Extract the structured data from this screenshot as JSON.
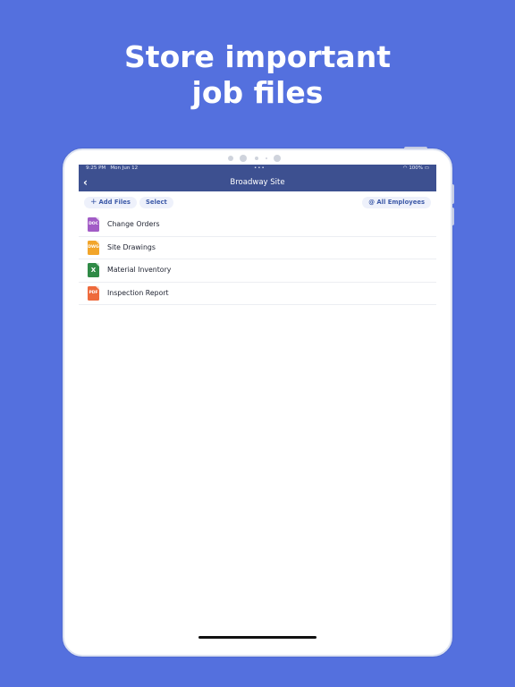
{
  "headline": {
    "line1": "Store important",
    "line2": "job files"
  },
  "status_bar": {
    "time": "9:25 PM",
    "date": "Mon Jun 12",
    "dots": "•••",
    "battery": "100%"
  },
  "nav": {
    "back_glyph": "‹",
    "title": "Broadway Site"
  },
  "toolbar": {
    "add_files_icon": "+",
    "add_files_label": "Add Files",
    "select_label": "Select",
    "filter_icon": "@",
    "filter_label": "All Employees"
  },
  "files": [
    {
      "name": "Change Orders",
      "type": "DOC",
      "color": "#a25cc6"
    },
    {
      "name": "Site Drawings",
      "type": "DWG",
      "color": "#f2a52a"
    },
    {
      "name": "Material Inventory",
      "type": "X",
      "color": "#2f8a46"
    },
    {
      "name": "Inspection Report",
      "type": "PDF",
      "color": "#ee6a3c"
    }
  ],
  "colors": {
    "background": "#5470de",
    "navbar": "#3d5090",
    "accent": "#3d5aa8"
  }
}
